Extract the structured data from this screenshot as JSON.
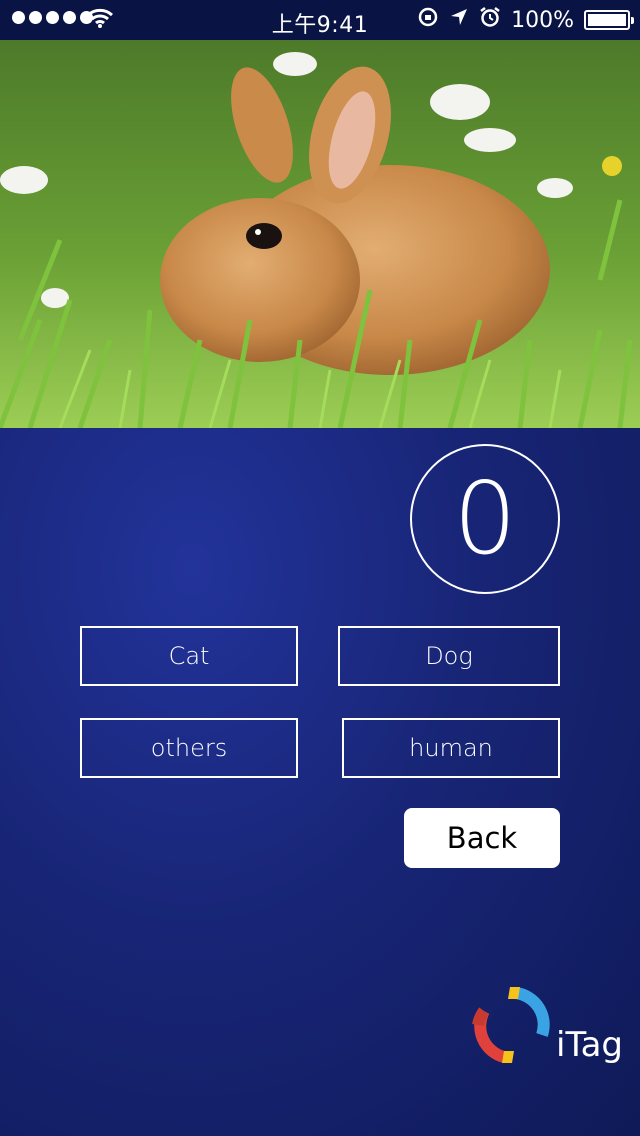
{
  "status_bar": {
    "time": "上午9:41",
    "battery": "100%"
  },
  "photo": {
    "subject": "rabbit-in-grass"
  },
  "counter": {
    "value": "0"
  },
  "options": [
    {
      "label": "Cat"
    },
    {
      "label": "Dog"
    },
    {
      "label": "others"
    },
    {
      "label": "human"
    }
  ],
  "back_button": {
    "label": "Back"
  },
  "logo": {
    "brand": "iTag"
  },
  "colors": {
    "background": "#172575",
    "status_bar": "#0a1444",
    "foreground": "#ffffff",
    "logo_blue": "#3aa3e3",
    "logo_red": "#e0413a",
    "logo_yellow": "#f5c31c"
  }
}
